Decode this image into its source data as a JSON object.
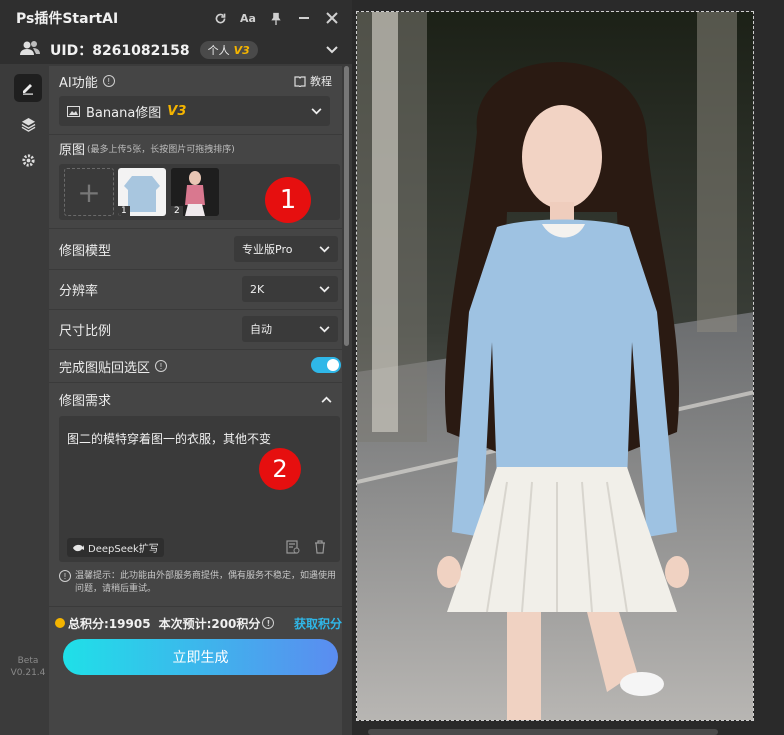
{
  "window": {
    "title": "Ps插件StartAI"
  },
  "account": {
    "uid": "UID：8261082158",
    "plan": "个人",
    "plan_level": "V3"
  },
  "sidebar": {
    "version_line1": "Beta",
    "version_line2": "V0.21.4"
  },
  "ai_function": {
    "label": "AI功能",
    "tutorial": "教程",
    "selected": "Banana修图",
    "level": "V3"
  },
  "source_images": {
    "label": "原图",
    "hint": "(最多上传5张，长按图片可拖拽排序)",
    "items": [
      {
        "index": "1"
      },
      {
        "index": "2"
      }
    ],
    "badge": "1"
  },
  "settings": {
    "model_label": "修图模型",
    "model_value": "专业版Pro",
    "resolution_label": "分辨率",
    "resolution_value": "2K",
    "ratio_label": "尺寸比例",
    "ratio_value": "自动",
    "paste_back_label": "完成图贴回选区",
    "paste_back_on": true
  },
  "prompt": {
    "label": "修图需求",
    "text": "图二的模特穿着图一的衣服，其他不变",
    "badge": "2",
    "deepseek_label": "DeepSeek扩写"
  },
  "notice": "温馨提示：此功能由外部服务商提供，偶有服务不稳定，如遇使用问题，请稍后重试。",
  "points": {
    "total": "总积分:19905",
    "estimate": "本次预计:200积分",
    "get_label": "获取积分"
  },
  "actions": {
    "generate_label": "立即生成"
  },
  "colors": {
    "accent": "#2fb7e8",
    "badge_red": "#e60f0f",
    "gold": "#f4b400"
  }
}
